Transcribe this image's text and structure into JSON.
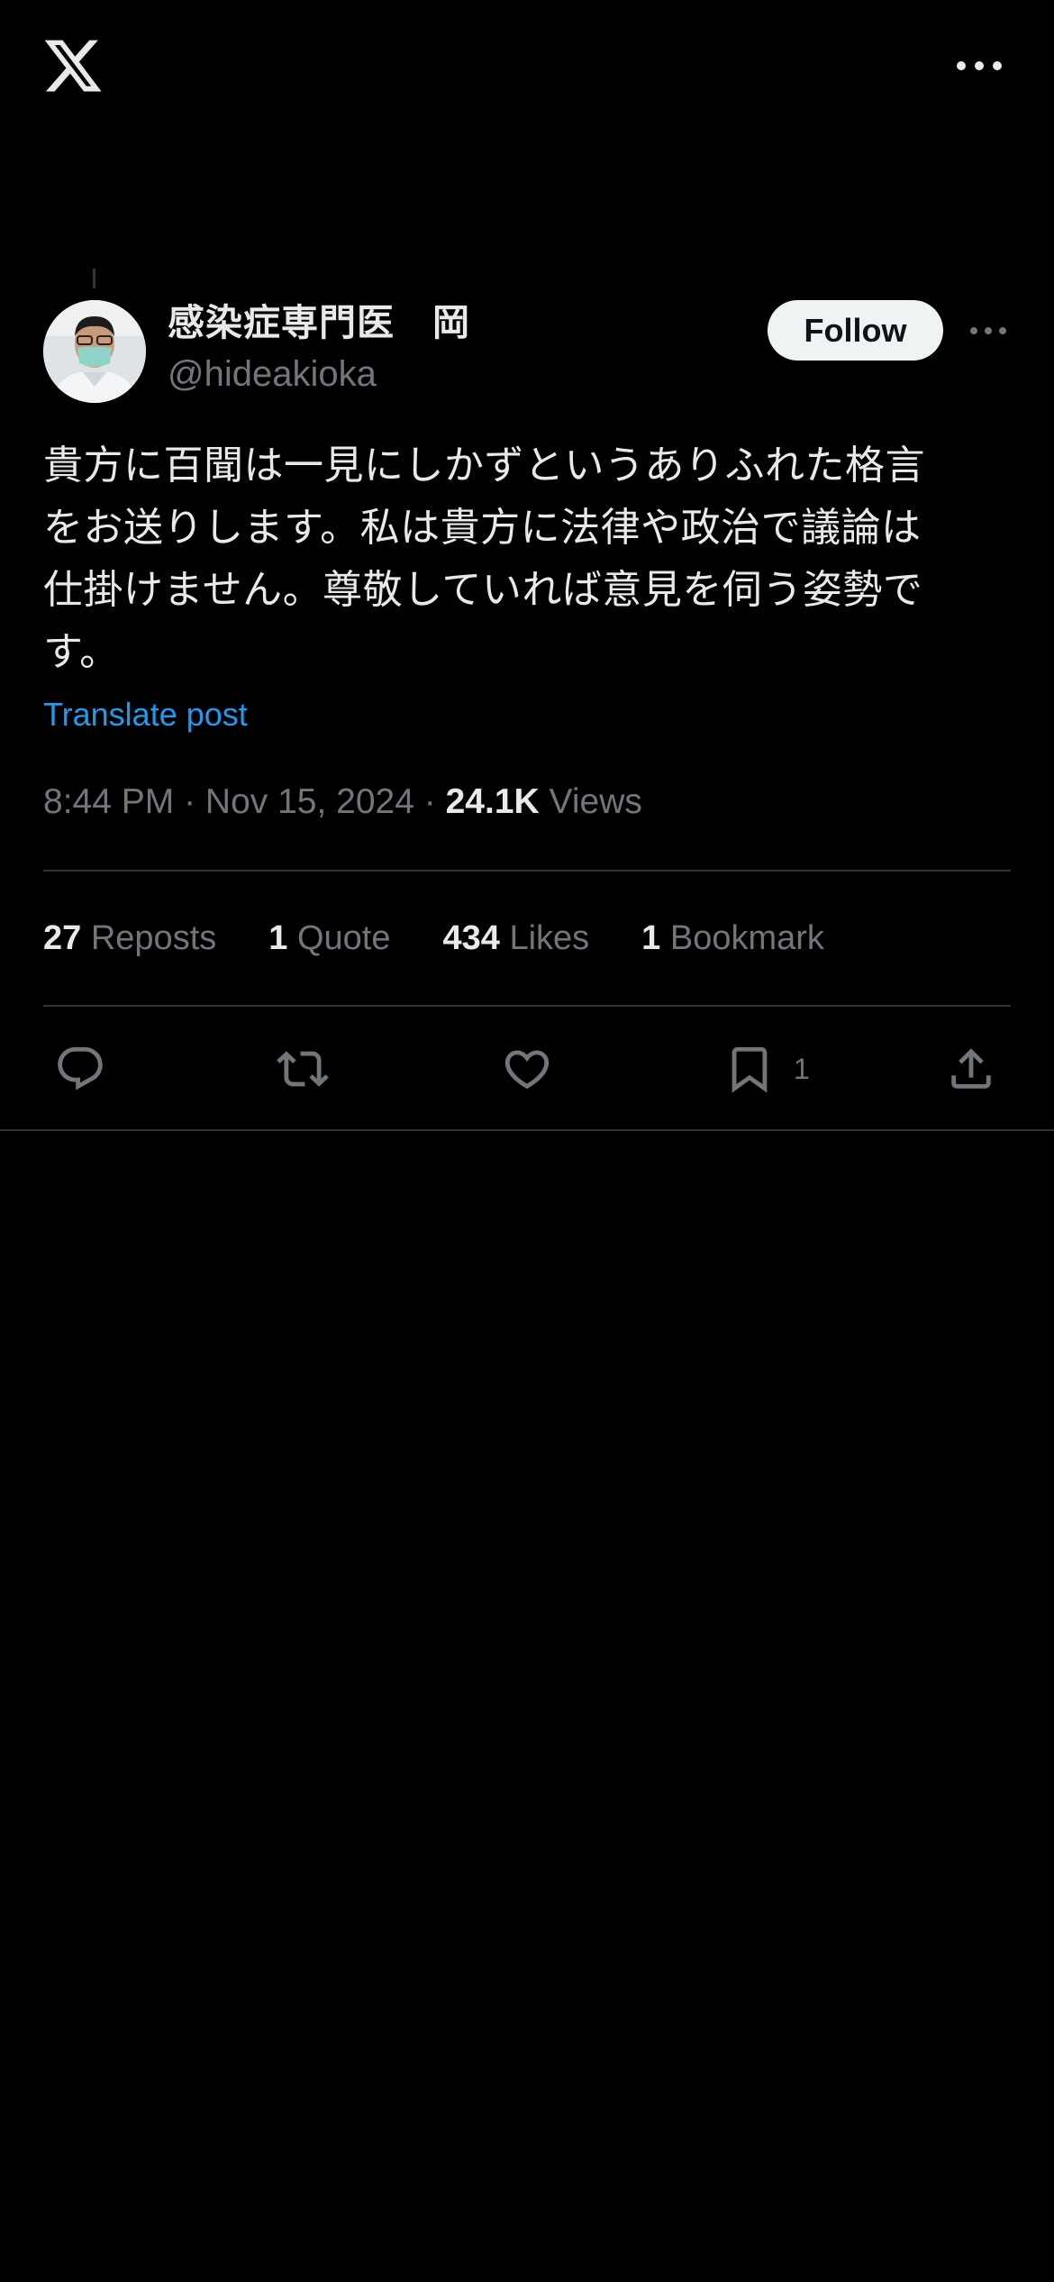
{
  "header": {
    "logo_icon": "x-logo-icon",
    "more_icon": "more-horizontal-icon"
  },
  "author": {
    "display_name": "感染症専門医　岡",
    "handle": "@hideakioka",
    "follow_label": "Follow",
    "avatar": "avatar-photo"
  },
  "post": {
    "text_lines": [
      "貴方に百聞は一見にしかずというありふれた格言",
      "をお送りします。私は貴方に法律や政治で議論は",
      "仕掛けません。尊敬していれば意見を伺う姿勢で",
      "す。"
    ],
    "translate_label": "Translate post",
    "time": "8:44 PM",
    "date": "Nov 15, 2024",
    "separator": " · ",
    "views_count": "24.1K",
    "views_label": "Views"
  },
  "stats": [
    {
      "count": "27",
      "label": "Reposts"
    },
    {
      "count": "1",
      "label": "Quote"
    },
    {
      "count": "434",
      "label": "Likes"
    },
    {
      "count": "1",
      "label": "Bookmark"
    }
  ],
  "actions": {
    "reply_icon": "reply-icon",
    "repost_icon": "repost-icon",
    "like_icon": "like-icon",
    "bookmark_icon": "bookmark-icon",
    "bookmark_count": "1",
    "share_icon": "share-icon"
  },
  "colors": {
    "background": "#000000",
    "text": "#e7e9ea",
    "secondary": "#71767b",
    "link": "#1d9bf0",
    "divider": "#2f3336"
  }
}
